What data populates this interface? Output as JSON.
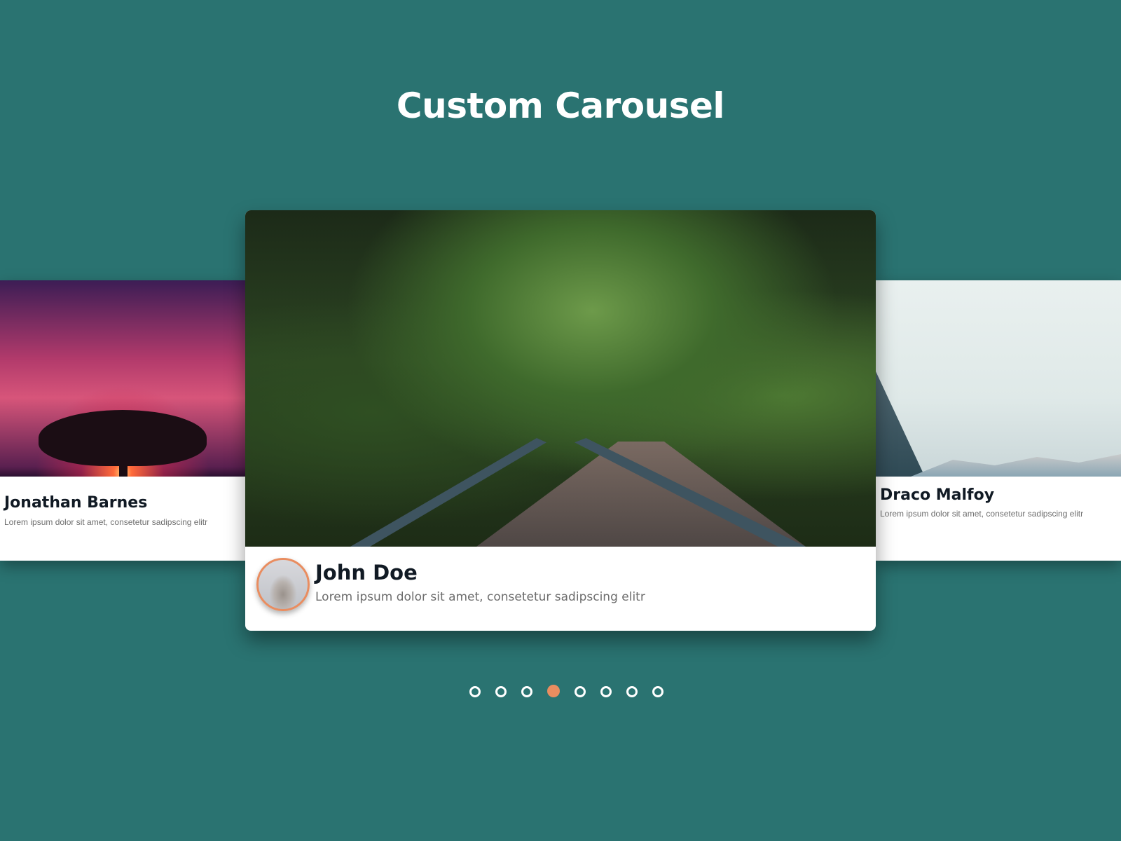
{
  "title": "Custom Carousel",
  "accent_color": "#e98d60",
  "background_color": "#2a7371",
  "cards": [
    {
      "name": "Jonathan Barnes",
      "visible_name": "nathan Barnes",
      "description": "Lorem ipsum dolor sit amet, consetetur sadipscing elitr",
      "image": "sunset-tree"
    },
    {
      "name": "John Doe",
      "description": "Lorem ipsum dolor sit amet, consetetur sadipscing elitr",
      "image": "forest-bridge"
    },
    {
      "name": "Draco Malfoy",
      "description": "Lorem ipsum dolor sit amet, consetetur sadipscing elitr",
      "image": "mountains"
    }
  ],
  "pagination": {
    "total": 8,
    "active_index": 3
  }
}
